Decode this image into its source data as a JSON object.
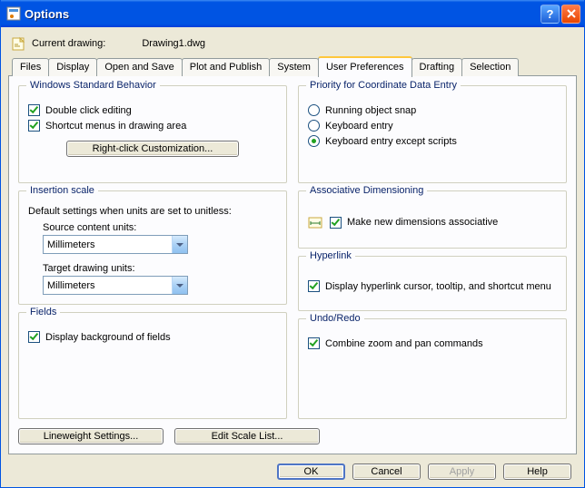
{
  "window": {
    "title": "Options"
  },
  "header": {
    "current_drawing_label": "Current drawing:",
    "current_drawing_value": "Drawing1.dwg"
  },
  "tabs": [
    {
      "label": "Files"
    },
    {
      "label": "Display"
    },
    {
      "label": "Open and Save"
    },
    {
      "label": "Plot and Publish"
    },
    {
      "label": "System"
    },
    {
      "label": "User Preferences",
      "active": true
    },
    {
      "label": "Drafting"
    },
    {
      "label": "Selection"
    }
  ],
  "wsb": {
    "legend": "Windows Standard Behavior",
    "double_click": {
      "label": "Double click editing",
      "checked": true,
      "hotkey": "D"
    },
    "shortcut_menus": {
      "label": "Shortcut menus in drawing area",
      "checked": true,
      "hotkey": "S"
    },
    "rc_button": "Right-click Customization...",
    "rc_hotkey": "R"
  },
  "ins": {
    "legend": "Insertion scale",
    "note": "Default settings when units are set to unitless:",
    "src_label": "Source content units:",
    "src_hotkey": "S",
    "src_value": "Millimeters",
    "tgt_label": "Target drawing units:",
    "tgt_hotkey": "T",
    "tgt_value": "Millimeters"
  },
  "fields": {
    "legend": "Fields",
    "bg": {
      "label": "Display background of fields",
      "checked": true,
      "hotkey": "b"
    }
  },
  "prio": {
    "legend": "Priority for Coordinate Data Entry",
    "opts": [
      {
        "label": "Running object snap",
        "hotkey": "R",
        "checked": false
      },
      {
        "label": "Keyboard entry",
        "hotkey": "K",
        "checked": false
      },
      {
        "label": "Keyboard entry except scripts",
        "hotkey": "x",
        "checked": true
      }
    ]
  },
  "assoc": {
    "legend": "Associative Dimensioning",
    "item": {
      "label": "Make new dimensions associative",
      "checked": true,
      "hotkey": "M"
    }
  },
  "hyper": {
    "legend": "Hyperlink",
    "item": {
      "label": "Display hyperlink cursor, tooltip, and shortcut menu",
      "checked": true,
      "hotkey": "D"
    }
  },
  "undo": {
    "legend": "Undo/Redo",
    "item": {
      "label": "Combine zoom and pan commands",
      "checked": true,
      "hotkey": "C"
    }
  },
  "bottom": {
    "lineweight": "Lineweight Settings...",
    "lineweight_hotkey": "L",
    "editscale": "Edit Scale List...",
    "editscale_hotkey": "E"
  },
  "dlg": {
    "ok": "OK",
    "cancel": "Cancel",
    "apply": "Apply",
    "apply_hotkey": "A",
    "apply_enabled": false,
    "help": "Help",
    "help_hotkey": "H"
  }
}
